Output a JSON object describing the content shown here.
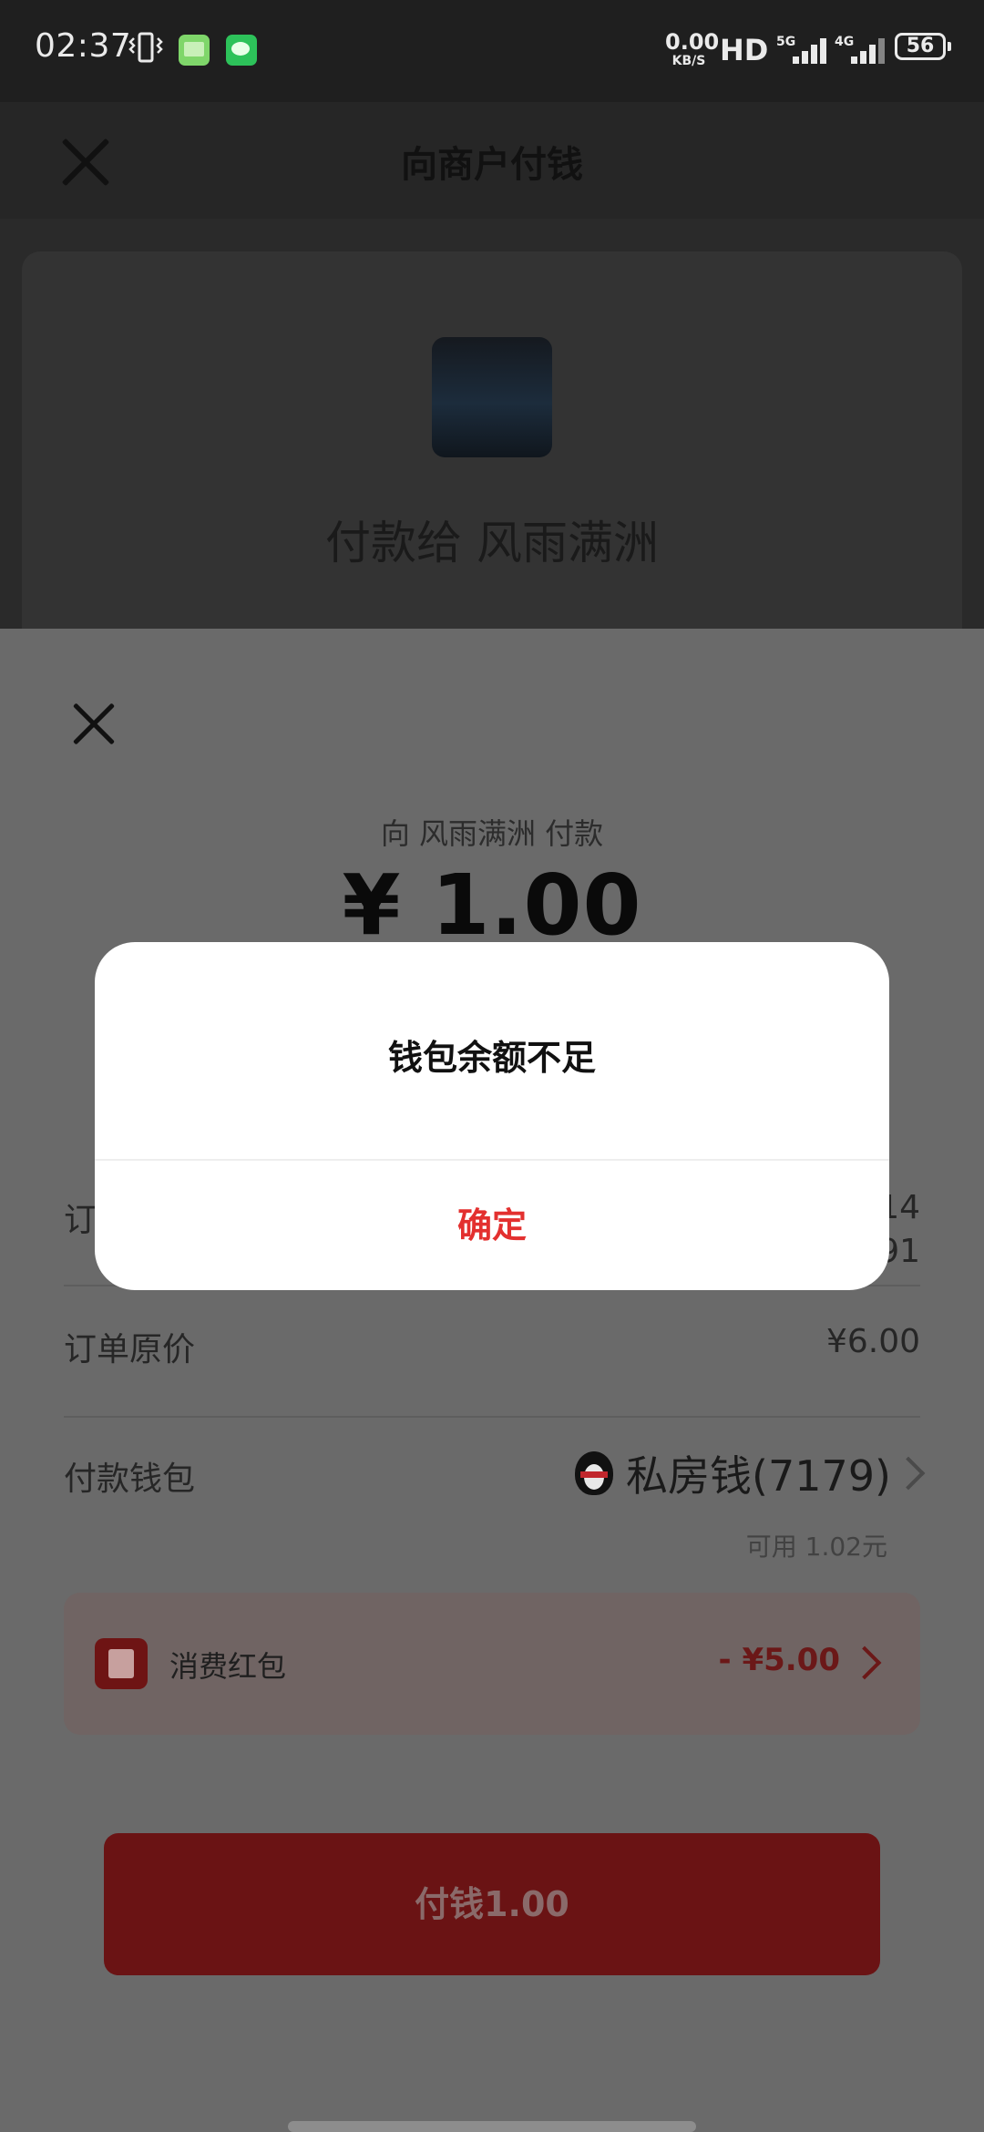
{
  "status_bar": {
    "time": "02:37",
    "net_speed_value": "0.00",
    "net_speed_unit": "KB/S",
    "hd_label": "HD",
    "sim1_network": "5G",
    "sim2_network": "4G",
    "battery": "56"
  },
  "header": {
    "title": "向商户付钱"
  },
  "merchant_card": {
    "pay_to": "付款给 风雨满洲"
  },
  "payment_sheet": {
    "pay_to_line": "向 风雨满洲 付款",
    "amount": "¥ 1.00",
    "order_label": "订",
    "order_value_line1": "14",
    "order_value_line2": "91",
    "original_price_label": "订单原价",
    "original_price_value": "¥6.00",
    "wallet_label": "付款钱包",
    "wallet_name": "私房钱(7179)",
    "wallet_available": "可用 1.02元",
    "coupon_label": "消费红包",
    "coupon_value": "- ¥5.00",
    "pay_button_label": "付钱1.00"
  },
  "dialog": {
    "message": "钱包余额不足",
    "confirm_label": "确定",
    "confirm_color": "#e3302f"
  },
  "icons": [
    "close-icon",
    "vibrate-icon",
    "gallery-app-icon",
    "wechat-app-icon",
    "penguin-wallet-icon",
    "chevron-right-icon",
    "red-packet-icon"
  ]
}
